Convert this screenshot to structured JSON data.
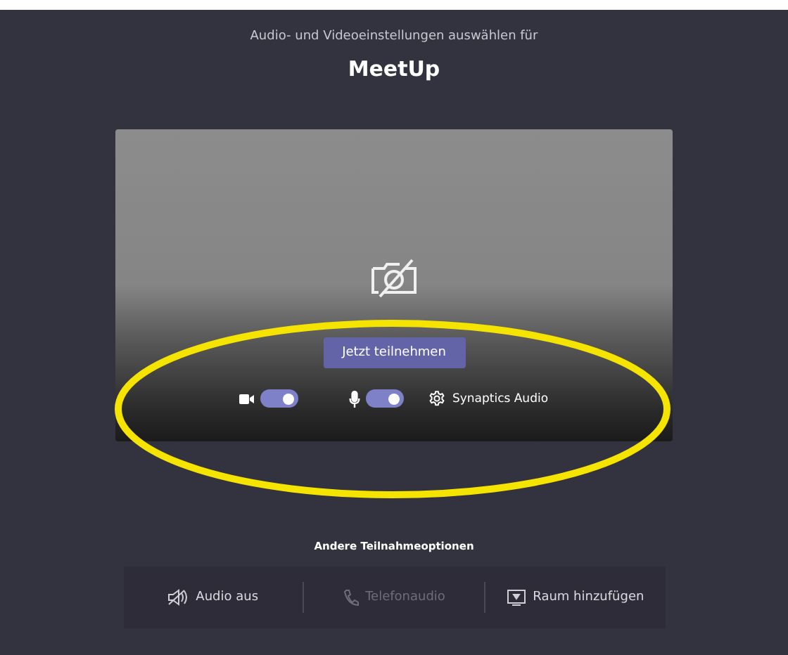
{
  "header": {
    "subtitle": "Audio- und Videoeinstellungen auswählen für",
    "title": "MeetUp"
  },
  "preview": {
    "join_button": "Jetzt teilnehmen",
    "video_toggle": {
      "on": true
    },
    "mic_toggle": {
      "on": true
    },
    "audio_device": "Synaptics Audio"
  },
  "annotation": {
    "kind": "ellipse",
    "color": "#f5e400"
  },
  "other_options": {
    "heading": "Andere Teilnahmeoptionen",
    "items": [
      {
        "kind": "audio-off",
        "label": "Audio aus",
        "disabled": false
      },
      {
        "kind": "phone",
        "label": "Telefonaudio",
        "disabled": true
      },
      {
        "kind": "room",
        "label": "Raum hinzufügen",
        "disabled": false
      }
    ]
  }
}
